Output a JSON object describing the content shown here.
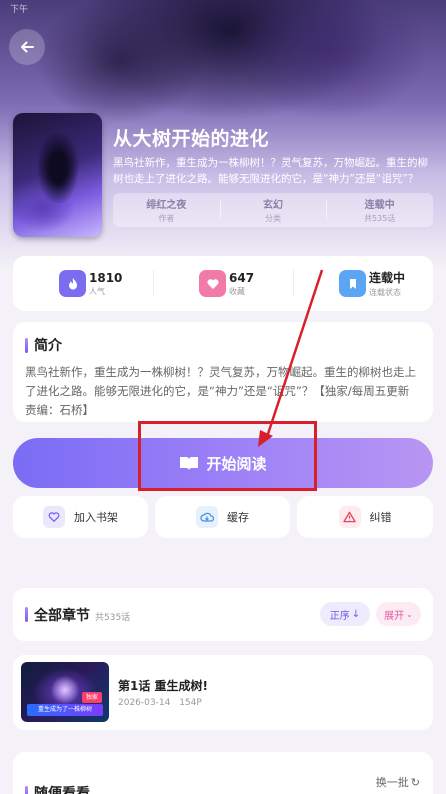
{
  "status_bar": {
    "text": "下午"
  },
  "book": {
    "title": "从大树开始的进化",
    "description": "黑鸟社新作，重生成为一株柳树！？灵气复苏，万物崛起。重生的柳树也走上了进化之路。能够无限进化的它，是“神力”还是“诅咒”？【独家/每周五更新",
    "meta": [
      {
        "value": "绯红之夜",
        "label": "作者"
      },
      {
        "value": "玄幻",
        "label": "分类"
      },
      {
        "value": "连载中",
        "label": "共535话"
      }
    ]
  },
  "stats": [
    {
      "value": "1810",
      "label": "人气",
      "icon": "flame-icon",
      "color": "#7b6cf0"
    },
    {
      "value": "647",
      "label": "收藏",
      "icon": "heart-icon",
      "color": "#f07aa8"
    },
    {
      "value": "连载中",
      "label": "连载状态",
      "icon": "bookmark-icon",
      "color": "#5aa6f5"
    }
  ],
  "intro": {
    "title": "简介",
    "text": "黑鸟社新作，重生成为一株柳树！？灵气复苏，万物崛起。重生的柳树也走上了进化之路。能够无限进化的它，是“神力”还是“诅咒”？【独家/每周五更新 责编：石桥】"
  },
  "read_button": {
    "label": "开始阅读"
  },
  "actions": [
    {
      "label": "加入书架",
      "icon": "heart-icon"
    },
    {
      "label": "缓存",
      "icon": "cloud-download-icon"
    },
    {
      "label": "纠错",
      "icon": "warning-icon"
    }
  ],
  "chapters": {
    "title": "全部章节",
    "count": "共535话",
    "sort_label": "正序",
    "expand_label": "展开",
    "items": [
      {
        "title": "第1话 重生成树!",
        "date": "2026-03-14",
        "pages": "154P",
        "thumb_banner": "重生成为了一株柳树",
        "thumb_tag": "独家"
      }
    ]
  },
  "random": {
    "title": "随便看看",
    "refresh_label": "换一批"
  },
  "colors": {
    "accent": "#7a6cf5",
    "annotation": "#d9202a"
  }
}
